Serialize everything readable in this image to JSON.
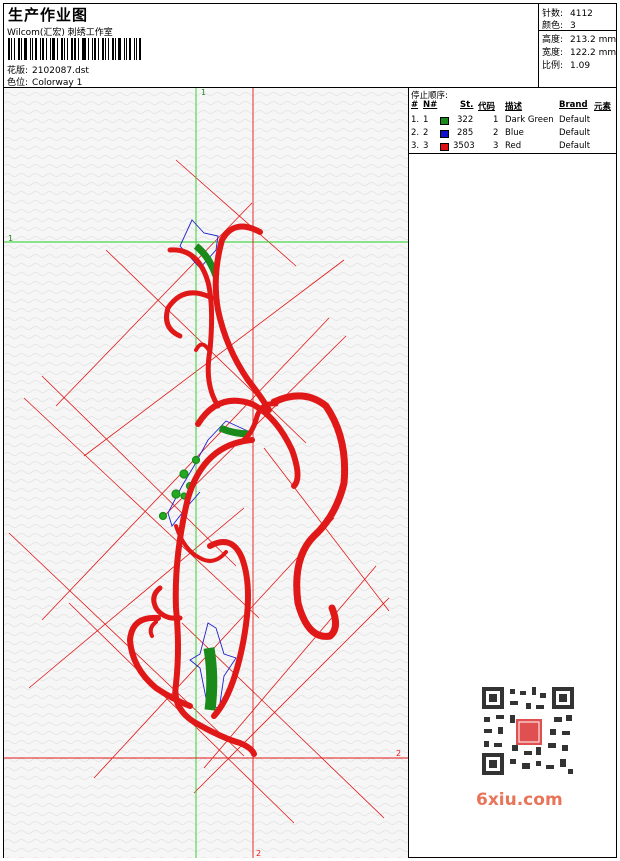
{
  "header": {
    "title": "生产作业图",
    "subtitle": "Wilcom(汇宏) 刺绣工作室",
    "design_label": "花版:",
    "design_value": "2102087.dst",
    "colorway_label": "色位:",
    "colorway_value": "Colorway 1"
  },
  "stats": [
    {
      "label": "针数:",
      "value": "4112"
    },
    {
      "label": "颜色:",
      "value": "3"
    },
    {
      "label": "高度:",
      "value": "213.2 mm"
    },
    {
      "label": "宽度:",
      "value": "122.2 mm"
    },
    {
      "label": "比例:",
      "value": "1.09"
    }
  ],
  "sequence": {
    "title": "停止顺序:",
    "columns": {
      "num": "#",
      "no": "N#",
      "st": "St.",
      "code": "代码",
      "desc": "描述",
      "brand": "Brand",
      "elem": "元素"
    },
    "rows": [
      {
        "num": "1.",
        "no": "1",
        "color": "#1a8a1a",
        "st": "322",
        "code": "1",
        "desc": "Dark Green",
        "brand": "Default"
      },
      {
        "num": "2.",
        "no": "2",
        "color": "#1010cc",
        "st": "285",
        "code": "2",
        "desc": "Blue",
        "brand": "Default"
      },
      {
        "num": "3.",
        "no": "3",
        "color": "#e01010",
        "st": "3503",
        "code": "3",
        "desc": "Red",
        "brand": "Default"
      }
    ]
  },
  "guides": {
    "green_v": "1",
    "green_h": "1",
    "red_v": "2",
    "red_h": "2"
  },
  "colors": {
    "green": "#22cc22",
    "red": "#e01818",
    "blue": "#2020cc",
    "dark_green": "#1a8a1a"
  },
  "watermark": {
    "text": "6xiu.com",
    "icon": "qr-code-icon"
  }
}
